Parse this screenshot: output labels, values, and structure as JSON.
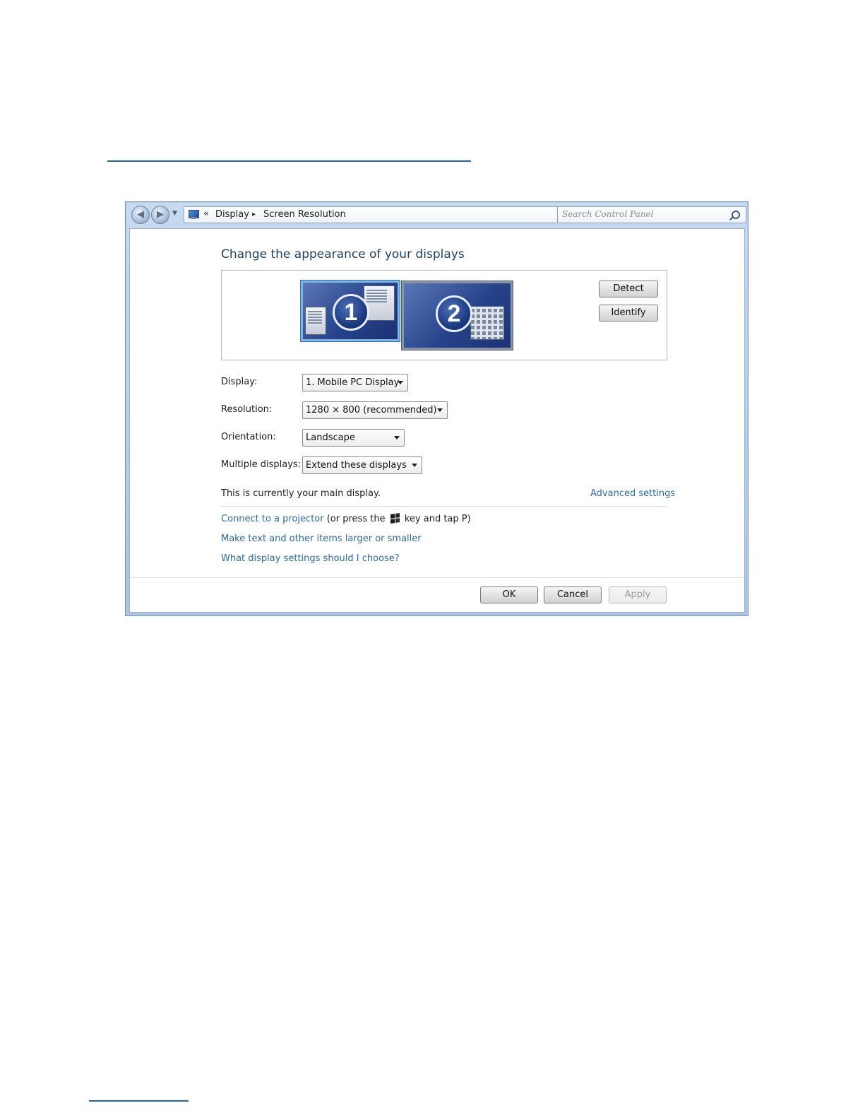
{
  "breadcrumb": {
    "overflow": "«",
    "items": [
      "Display",
      "Screen Resolution"
    ],
    "separator": "▸"
  },
  "search": {
    "placeholder": "Search Control Panel"
  },
  "page": {
    "title": "Change the appearance of your displays"
  },
  "monitors": [
    {
      "number": "1",
      "selected": true
    },
    {
      "number": "2",
      "selected": false
    }
  ],
  "buttons": {
    "detect": "Detect",
    "identify": "Identify",
    "ok": "OK",
    "cancel": "Cancel",
    "apply": "Apply"
  },
  "fields": {
    "display": {
      "label": "Display:",
      "value": "1. Mobile PC Display"
    },
    "resolution": {
      "label": "Resolution:",
      "value": "1280 × 800 (recommended)"
    },
    "orientation": {
      "label": "Orientation:",
      "value": "Landscape"
    },
    "multiple": {
      "label": "Multiple displays:",
      "value": "Extend these displays"
    }
  },
  "status": {
    "main_display": "This is currently your main display."
  },
  "links": {
    "advanced": "Advanced settings",
    "projector": "Connect to a projector",
    "projector_suffix_a": "(or press the",
    "projector_suffix_b": "key and tap P)",
    "larger": "Make text and other items larger or smaller",
    "what": "What display settings should I choose?"
  },
  "colors": {
    "link": "#2a6aa8",
    "title": "#1e3f66",
    "page_rule": "#1f64c4",
    "selected_monitor_border": "#7fb6e8"
  }
}
